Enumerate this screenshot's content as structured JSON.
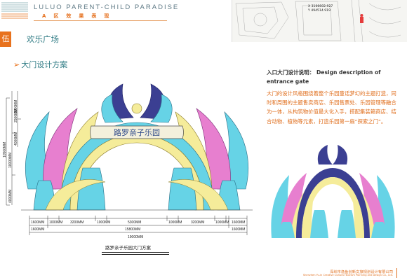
{
  "header": {
    "title": "LULUO PARENT-CHILD PARADISE",
    "subtitle": "A区效果表现"
  },
  "section": {
    "badge": "伍",
    "title": "欢乐广场",
    "subtitle": "大门设计方案"
  },
  "map": {
    "coord_lines": [
      "X 3106602.927",
      "Y 494514.919"
    ]
  },
  "description": {
    "title": "入口大门设计说明： Design description of entrance gate",
    "body": "大门的设计风格围绕着整个乐园童话梦幻的主题打造，同时和周围的主题售卖商店、乐园售票处、乐园管理等融合为一体，从构筑物价值最大化入手，搭配集装箱商店、结合动物、植物等元素，打造乐园第一扇“探索之门”。"
  },
  "drawing": {
    "sign_text": "路罗亲子乐园",
    "caption": "路罗亲子乐园大门方案",
    "dims_top": [
      "1600MM",
      "1000MM",
      "3200MM",
      "1000MM",
      "5300MM",
      "1000MM",
      "3200MM",
      "1000MM",
      "1600MM"
    ],
    "dims_mid": [
      "1600MM",
      "15800MM",
      "1600MM"
    ],
    "dims_bottom": "19000MM",
    "dims_left": [
      "10500MM",
      "10000MM",
      "4000MM",
      "2500MM",
      "4000MM",
      "3000MM"
    ]
  },
  "footer": {
    "company_cn": "深圳市逸鱼创新文旅规划设计有限公司",
    "company_en": "Shenzhen Yu-in Creative Cultural Tourism Planning and Design Co., Ltd."
  },
  "colors": {
    "accent_orange": "#e8721d",
    "teal_title": "#2f7b84",
    "gate_cyan": "#66d3e6",
    "gate_pink": "#e77fcf",
    "gate_yellow": "#f5ec9a",
    "gate_navy": "#3b3f92"
  }
}
